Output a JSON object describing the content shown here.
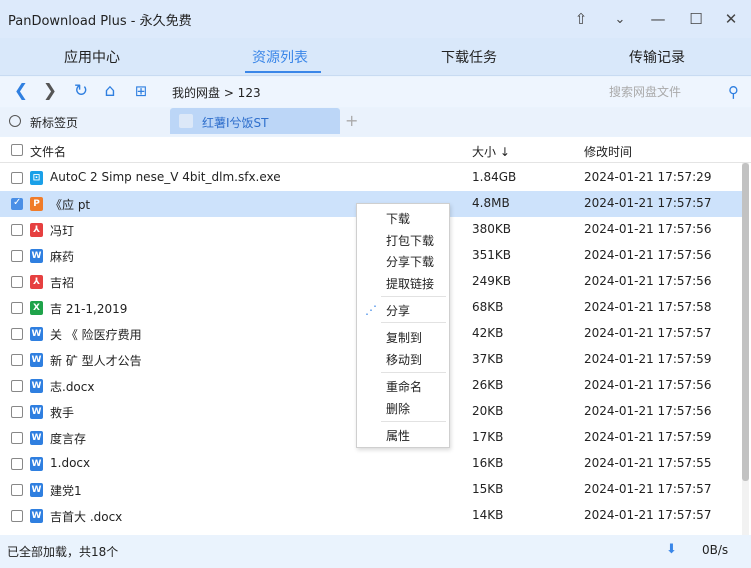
{
  "window": {
    "title": "PanDownload Plus - 永久免费",
    "controls": [
      "pin-icon",
      "chevron-down-icon",
      "minimize-icon",
      "maximize-icon",
      "close-icon"
    ]
  },
  "nav": {
    "tabs": [
      {
        "label": "应用中心",
        "active": false
      },
      {
        "label": "资源列表",
        "active": true
      },
      {
        "label": "下载任务",
        "active": false
      },
      {
        "label": "传输记录",
        "active": false
      }
    ]
  },
  "toolbar": {
    "icons": [
      "back-icon",
      "forward-icon",
      "refresh-icon",
      "home-icon",
      "new-folder-icon"
    ],
    "path": "我的网盘 > 123",
    "search_placeholder": "搜索网盘文件"
  },
  "tabstrip": {
    "new_tab_label": "新标签页",
    "user_tab_label": "红薯I兮饭ST"
  },
  "list": {
    "header": {
      "name": "文件名",
      "size": "大小 ↓",
      "modified": "修改时间"
    },
    "rows": [
      {
        "icon": "exe",
        "color": "#1aa0e8",
        "glyph": "⊡",
        "name": "AutoC       2       Simp            nese_V       4bit_dlm.sfx.exe",
        "size": "1.84GB",
        "date": "2024-01-21 17:57:29",
        "checked": false
      },
      {
        "icon": "ppt",
        "color": "#f07c2a",
        "glyph": "P",
        "name": "《应                 pt",
        "size": "4.8MB",
        "date": "2024-01-21 17:57:57",
        "checked": true
      },
      {
        "icon": "pdf",
        "color": "#e64040",
        "glyph": "⅄",
        "name": "冯玎",
        "size": "380KB",
        "date": "2024-01-21 17:57:56",
        "checked": false
      },
      {
        "icon": "doc",
        "color": "#2f7fe0",
        "glyph": "W",
        "name": "麻药",
        "size": "351KB",
        "date": "2024-01-21 17:57:56",
        "checked": false
      },
      {
        "icon": "pdf",
        "color": "#e64040",
        "glyph": "⅄",
        "name": "吉袑",
        "size": "249KB",
        "date": "2024-01-21 17:57:56",
        "checked": false
      },
      {
        "icon": "xls",
        "color": "#1fa34a",
        "glyph": "X",
        "name": "吉                              21-1,2019",
        "size": "68KB",
        "date": "2024-01-21 17:57:58",
        "checked": false
      },
      {
        "icon": "doc",
        "color": "#2f7fe0",
        "glyph": "W",
        "name": "关        《                                          险医疗费用",
        "size": "42KB",
        "date": "2024-01-21 17:57:57",
        "checked": false
      },
      {
        "icon": "doc",
        "color": "#2f7fe0",
        "glyph": "W",
        "name": "新              矿                                     型人才公告",
        "size": "37KB",
        "date": "2024-01-21 17:57:59",
        "checked": false
      },
      {
        "icon": "doc",
        "color": "#2f7fe0",
        "glyph": "W",
        "name": "                                                        志.docx",
        "size": "26KB",
        "date": "2024-01-21 17:57:56",
        "checked": false
      },
      {
        "icon": "doc",
        "color": "#2f7fe0",
        "glyph": "W",
        "name": "              救手",
        "size": "20KB",
        "date": "2024-01-21 17:57:56",
        "checked": false
      },
      {
        "icon": "doc",
        "color": "#2f7fe0",
        "glyph": "W",
        "name": "                 度言存",
        "size": "17KB",
        "date": "2024-01-21 17:57:59",
        "checked": false
      },
      {
        "icon": "doc",
        "color": "#2f7fe0",
        "glyph": "W",
        "name": "                                        1.docx",
        "size": "16KB",
        "date": "2024-01-21 17:57:55",
        "checked": false
      },
      {
        "icon": "doc",
        "color": "#2f7fe0",
        "glyph": "W",
        "name": "       建党1",
        "size": "15KB",
        "date": "2024-01-21 17:57:57",
        "checked": false
      },
      {
        "icon": "doc",
        "color": "#2f7fe0",
        "glyph": "W",
        "name": "吉首大                                     .docx",
        "size": "14KB",
        "date": "2024-01-21 17:57:57",
        "checked": false
      }
    ]
  },
  "context_menu": {
    "items": [
      "下载",
      "打包下载",
      "分享下载",
      "提取链接",
      "分享",
      "复制到",
      "移动到",
      "重命名",
      "删除",
      "属性"
    ]
  },
  "status": {
    "text": "已全部加载，共18个",
    "speed": "0B/s"
  }
}
